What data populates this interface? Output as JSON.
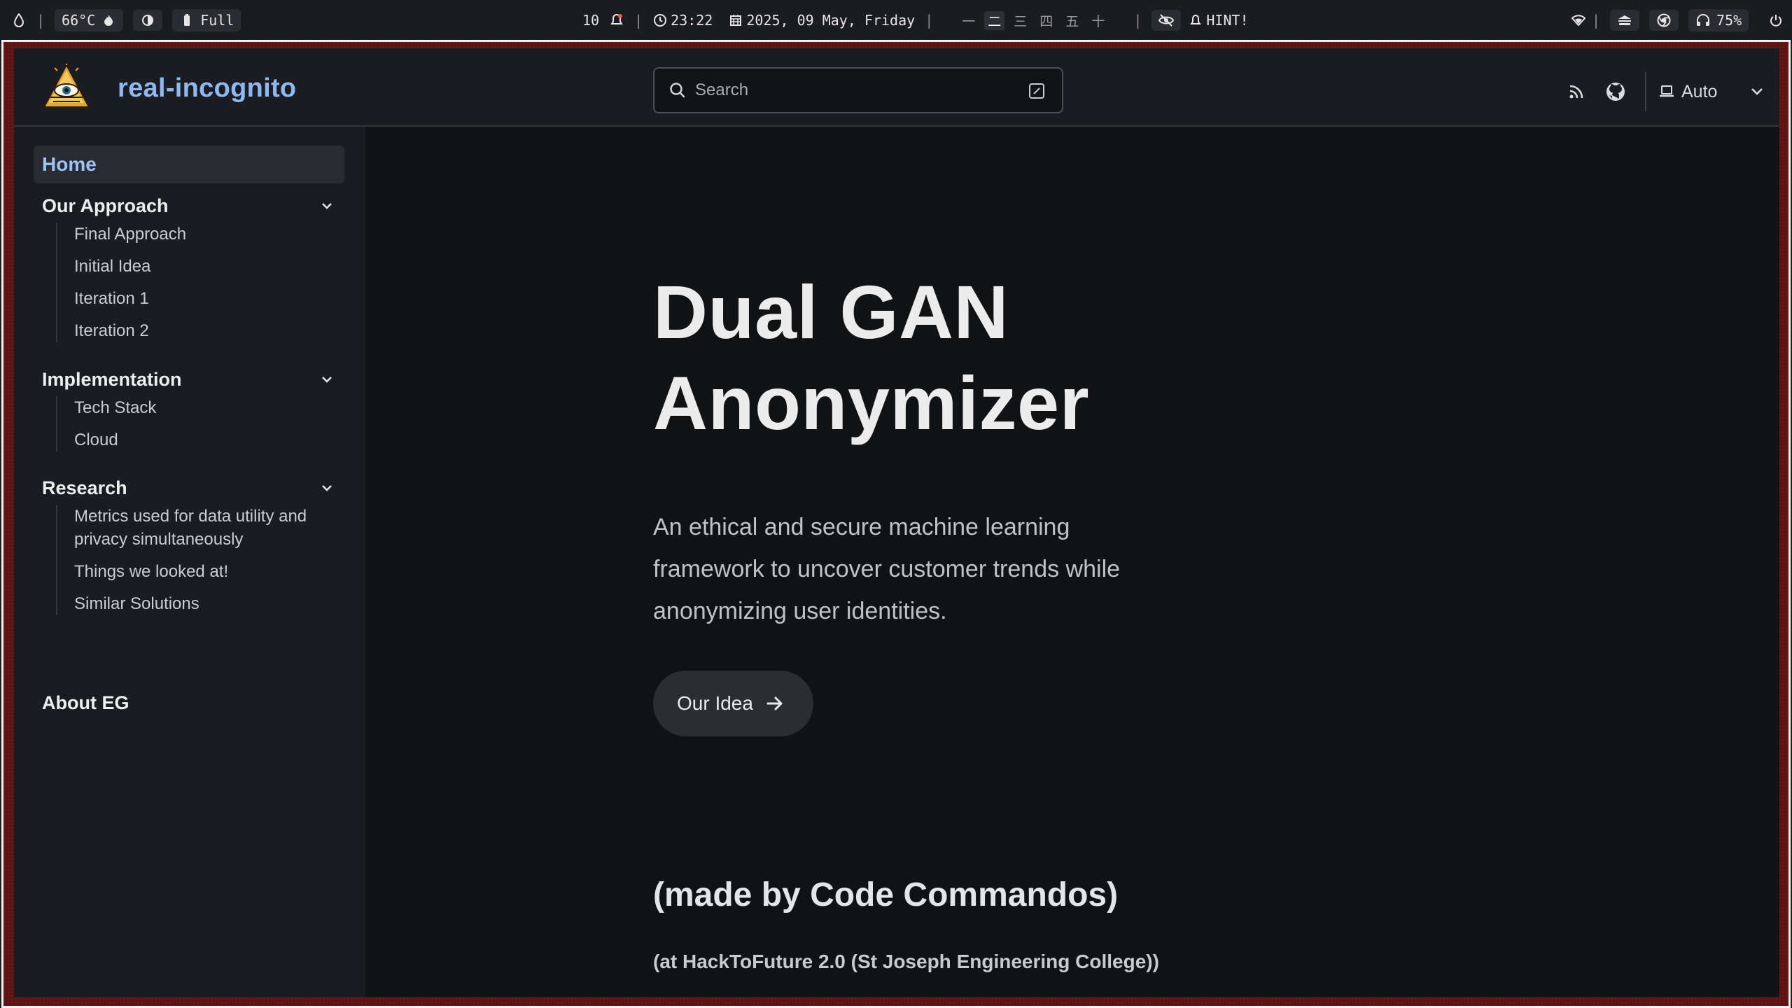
{
  "sysbar": {
    "temperature": "66°C",
    "power_mode": "Full",
    "notifications": "10",
    "time": "23:22",
    "date": "2025, 09 May, Friday",
    "workspaces": [
      "一",
      "二",
      "三",
      "四",
      "五",
      "十"
    ],
    "active_workspace": 1,
    "hint": "HINT!",
    "volume": "75%"
  },
  "header": {
    "site_title": "real-incognito",
    "search_placeholder": "Search",
    "theme_label": "Auto"
  },
  "sidebar": {
    "home": "Home",
    "sections": [
      {
        "title": "Our Approach",
        "items": [
          "Final Approach",
          "Initial Idea",
          "Iteration 1",
          "Iteration 2"
        ]
      },
      {
        "title": "Implementation",
        "items": [
          "Tech Stack",
          "Cloud"
        ]
      },
      {
        "title": "Research",
        "items": [
          "Metrics used for data utility and privacy simultaneously",
          "Things we looked at!",
          "Similar Solutions"
        ]
      }
    ],
    "about": "About EG"
  },
  "main": {
    "title_line1": "Dual GAN",
    "title_line2": "Anonymizer",
    "subtitle": "An ethical and secure machine learning framework to uncover customer trends while anonymizing user identities.",
    "cta_label": "Our Idea",
    "made_by": "(made by Code Commandos)",
    "made_at": "(at HackToFuture 2.0 (St Joseph Engineering College))"
  },
  "colors": {
    "accent": "#8fb8f2",
    "page_bg": "#111214",
    "sidebar_bg": "#1a1c21",
    "frame_border": "#5a1414"
  }
}
